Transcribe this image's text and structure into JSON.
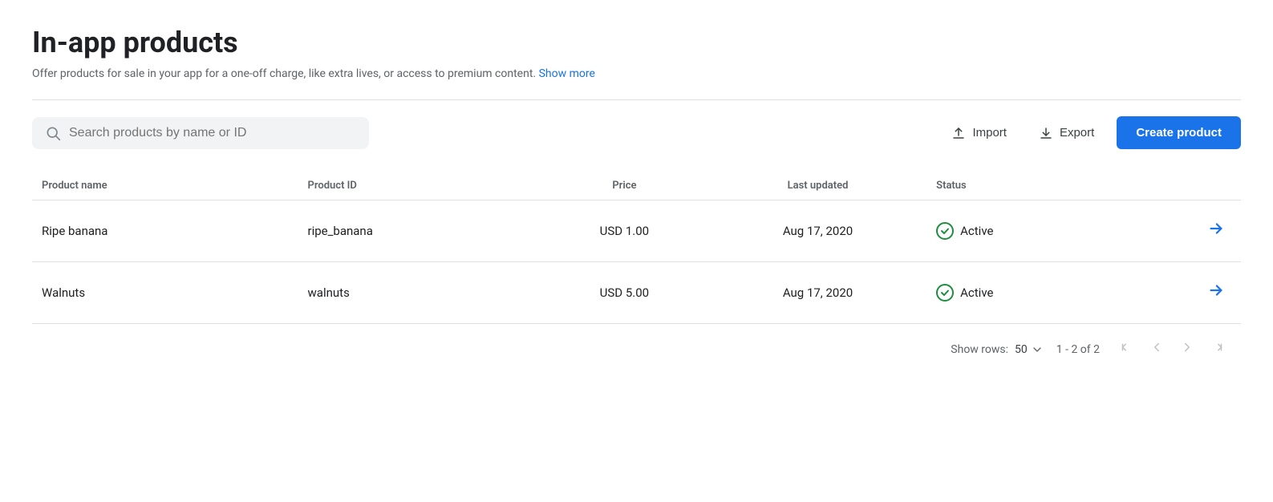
{
  "page": {
    "title": "In-app products",
    "subtitle": "Offer products for sale in your app for a one-off charge, like extra lives, or access to premium content.",
    "show_more_label": "Show more"
  },
  "toolbar": {
    "search_placeholder": "Search products by name or ID",
    "import_label": "Import",
    "export_label": "Export",
    "create_label": "Create product"
  },
  "table": {
    "columns": [
      "Product name",
      "Product ID",
      "Price",
      "Last updated",
      "Status"
    ],
    "rows": [
      {
        "name": "Ripe banana",
        "id": "ripe_banana",
        "price": "USD 1.00",
        "updated": "Aug 17, 2020",
        "status": "Active"
      },
      {
        "name": "Walnuts",
        "id": "walnuts",
        "price": "USD 5.00",
        "updated": "Aug 17, 2020",
        "status": "Active"
      }
    ]
  },
  "footer": {
    "show_rows_label": "Show rows:",
    "rows_count": "50",
    "pagination_info": "1 - 2 of 2"
  }
}
